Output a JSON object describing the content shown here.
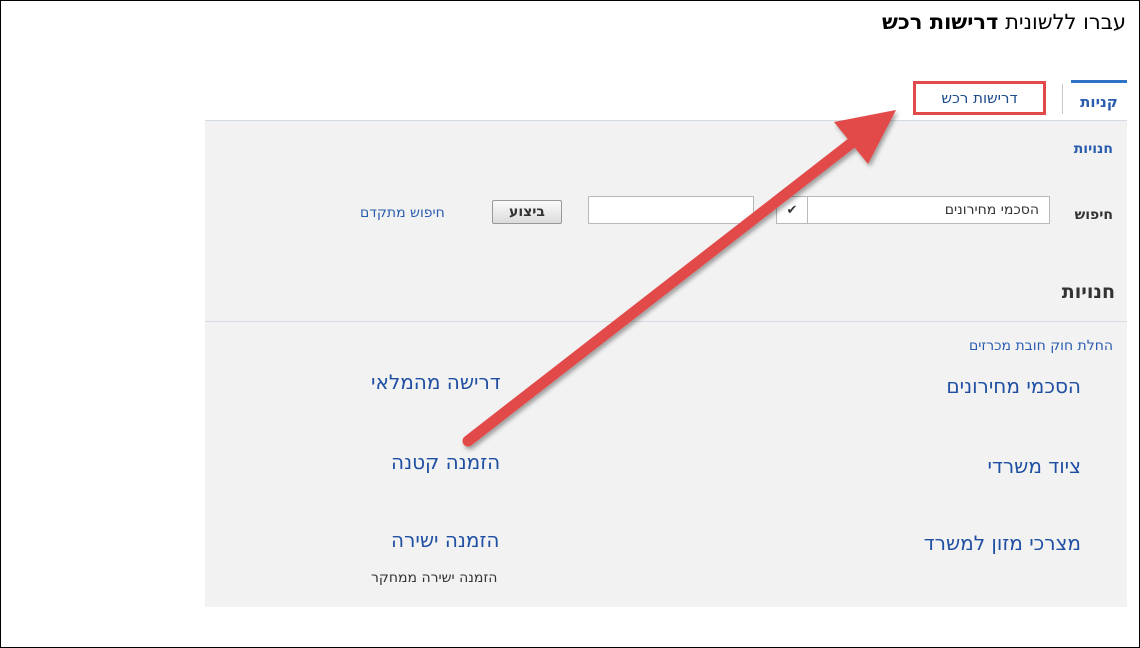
{
  "instruction": {
    "prefix": "עברו ללשונית",
    "bold": "דרישות רכש"
  },
  "tabs": {
    "active": "קניות",
    "highlighted": "דרישות רכש"
  },
  "panel": {
    "subnav": "חנויות",
    "search": {
      "label": "חיפוש",
      "select_value": "הסכמי מחירונים",
      "select_toggle": "✔",
      "input_value": "",
      "go_label": "ביצוע",
      "advanced_label": "חיפוש מתקדם"
    },
    "section_title": "חנויות",
    "small_link": "החלת חוק חובת מכרזים",
    "stores_right": [
      "הסכמי מחירונים",
      "ציוד משרדי",
      "מצרכי מזון למשרד"
    ],
    "stores_left": [
      "דרישה מהמלאי",
      "הזמנה קטנה",
      "הזמנה ישירה"
    ],
    "stores_left_sub": "הזמנה ישירה ממחקר"
  },
  "colors": {
    "accent_blue": "#2f73c6",
    "link_blue": "#1f4fa3",
    "highlight_red": "#e2494a"
  }
}
